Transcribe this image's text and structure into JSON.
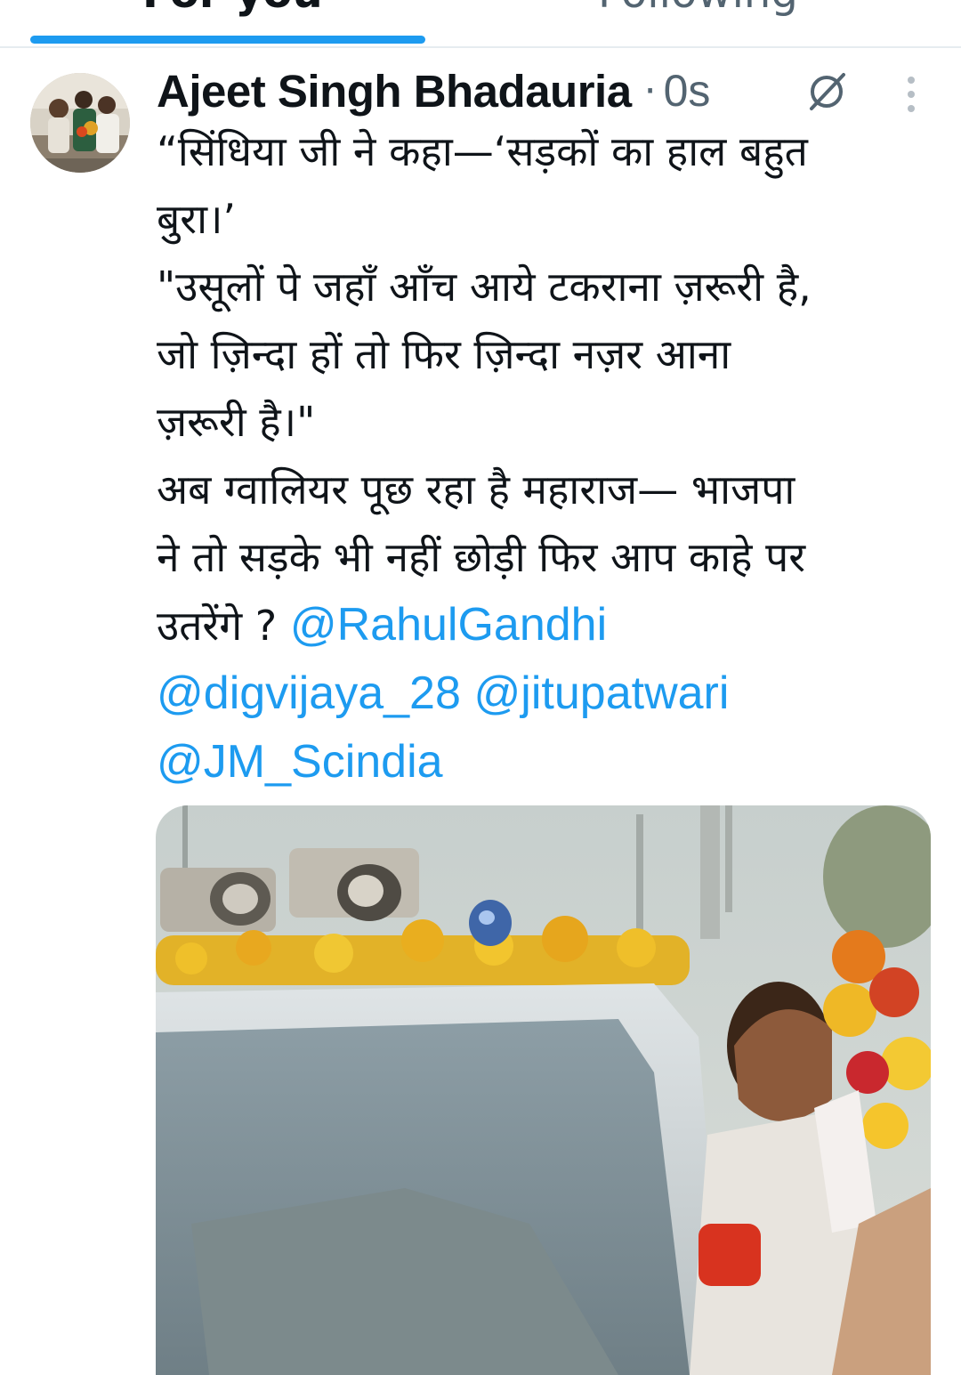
{
  "tabs": {
    "for_you": "For you",
    "following": "Following"
  },
  "tweet": {
    "author_name": "Ajeet Singh Bhadauria",
    "separator": "·",
    "timestamp": "0s",
    "lines": [
      "“सिंधिया जी ने कहा—‘सड़कों का हाल बहुत",
      "बुरा।’",
      "\"उसूलों पे जहाँ आँच आये टकराना ज़रूरी है,",
      "जो ज़िन्दा हों तो फिर ज़िन्दा नज़र आना",
      "ज़रूरी है।\"",
      "अब ग्वालियर पूछ रहा है महाराज— भाजपा",
      "ने तो सड़के भी नहीं छोड़ी फिर आप काहे पर"
    ],
    "last_line_prefix": "उतरेंगे ? ",
    "mentions": [
      "@RahulGandhi",
      "@digvijaya_28",
      "@jitupatwari",
      "@JM_Scindia"
    ],
    "icons": {
      "not_interested": "prohibited-circle-icon",
      "more": "vertical-ellipsis-icon"
    }
  },
  "colors": {
    "accent": "#1d9bf0",
    "text_primary": "#0f1419",
    "text_secondary": "#536471",
    "divider": "#e6ecf0"
  }
}
